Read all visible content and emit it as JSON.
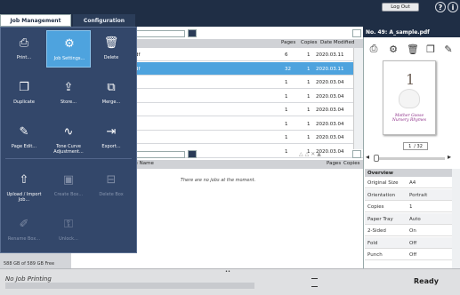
{
  "tabs": [
    {
      "label": "Job Management",
      "active": true
    },
    {
      "label": "Configuration",
      "active": false
    }
  ],
  "header": {
    "logout_label": "Log Out",
    "help_icon": "?",
    "info_icon": "i"
  },
  "menu": {
    "items": [
      {
        "label": "Print...",
        "icon": "print-icon",
        "disabled": false,
        "active": false
      },
      {
        "label": "Job Settings...",
        "icon": "job-settings-icon",
        "disabled": false,
        "active": true
      },
      {
        "label": "Delete",
        "icon": "trash-icon",
        "disabled": false,
        "active": false
      },
      {
        "label": "Duplicate",
        "icon": "duplicate-icon",
        "disabled": false,
        "active": false
      },
      {
        "label": "Store...",
        "icon": "store-icon",
        "disabled": false,
        "active": false
      },
      {
        "label": "Merge...",
        "icon": "merge-icon",
        "disabled": false,
        "active": false
      },
      {
        "label": "Page Edit...",
        "icon": "page-edit-icon",
        "disabled": false,
        "active": false
      },
      {
        "label": "Tone Curve Adjustment...",
        "icon": "tone-curve-icon",
        "disabled": false,
        "active": false
      },
      {
        "label": "Export...",
        "icon": "export-icon",
        "disabled": false,
        "active": false
      },
      {
        "label": "Upload / Import Job...",
        "icon": "upload-icon",
        "disabled": false,
        "active": false
      },
      {
        "label": "Create Box...",
        "icon": "create-box-icon",
        "disabled": true,
        "active": false
      },
      {
        "label": "Delete Box",
        "icon": "delete-box-icon",
        "disabled": true,
        "active": false
      },
      {
        "label": "Rename Box...",
        "icon": "rename-box-icon",
        "disabled": true,
        "active": false
      },
      {
        "label": "Unlock...",
        "icon": "unlock-icon",
        "disabled": true,
        "active": false
      }
    ]
  },
  "job_list": {
    "columns": {
      "pages": "Pages",
      "copies": "Copies",
      "date": "Date Modified"
    },
    "rows": [
      {
        "name": "df",
        "pages": "6",
        "copies": "1",
        "date": "2020.03.11",
        "selected": false
      },
      {
        "name": "df",
        "pages": "32",
        "copies": "1",
        "date": "2020.03.11",
        "selected": true
      },
      {
        "name": "",
        "pages": "1",
        "copies": "1",
        "date": "2020.03.04",
        "selected": false
      },
      {
        "name": "",
        "pages": "1",
        "copies": "1",
        "date": "2020.03.04",
        "selected": false
      },
      {
        "name": "",
        "pages": "1",
        "copies": "1",
        "date": "2020.03.04",
        "selected": false
      },
      {
        "name": "",
        "pages": "1",
        "copies": "1",
        "date": "2020.03.04",
        "selected": false
      },
      {
        "name": "",
        "pages": "1",
        "copies": "1",
        "date": "2020.03.04",
        "selected": false
      },
      {
        "name": "",
        "pages": "1",
        "copies": "1",
        "date": "2020.03.04",
        "selected": false
      }
    ]
  },
  "queue": {
    "columns": {
      "name": "le Name",
      "pages": "Pages",
      "copies": "Copies"
    },
    "empty_message": "There are no jobs at the moment."
  },
  "preview": {
    "title": "No. 49: A_sample.pdf",
    "page_number_big": "1",
    "book_title_line1": "Mother Goose",
    "book_title_line2": "Nursery Rhymes",
    "current_page": "1",
    "total_pages": "/ 32"
  },
  "overview": {
    "header": "Overview",
    "rows": [
      {
        "key": "Original Size",
        "value": "A4"
      },
      {
        "key": "Orientation",
        "value": "Portrait"
      },
      {
        "key": "Copies",
        "value": "1"
      },
      {
        "key": "Paper Tray",
        "value": "Auto"
      },
      {
        "key": "2-Sided",
        "value": "On"
      },
      {
        "key": "Fold",
        "value": "Off"
      },
      {
        "key": "Punch",
        "value": "Off"
      }
    ]
  },
  "storage": {
    "text": "588 GB of 589 GB Free"
  },
  "status": {
    "job_status": "No Job Printing",
    "printer_state": "Ready",
    "toggle": "••"
  },
  "colors": {
    "accent": "#4ea3de",
    "menu_bg": "#33476a",
    "topbar": "#1f2e45"
  }
}
